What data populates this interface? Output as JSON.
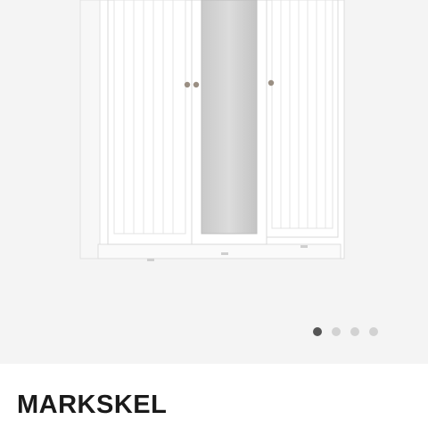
{
  "product": {
    "name": "MARKSKEL",
    "image_icon": "wardrobe-image"
  },
  "gallery": {
    "slide_count": 4,
    "active_index": 0,
    "dots": [
      {
        "label": "",
        "active": true
      },
      {
        "label": "",
        "active": false
      },
      {
        "label": "",
        "active": false
      },
      {
        "label": "",
        "active": false
      }
    ]
  },
  "colors": {
    "gallery_bg": "#f4f4f4",
    "wardrobe_body": "#ffffff",
    "dot_active": "#555555",
    "dot_inactive": "#d2d2d2",
    "title_text": "#1a1a1a"
  }
}
